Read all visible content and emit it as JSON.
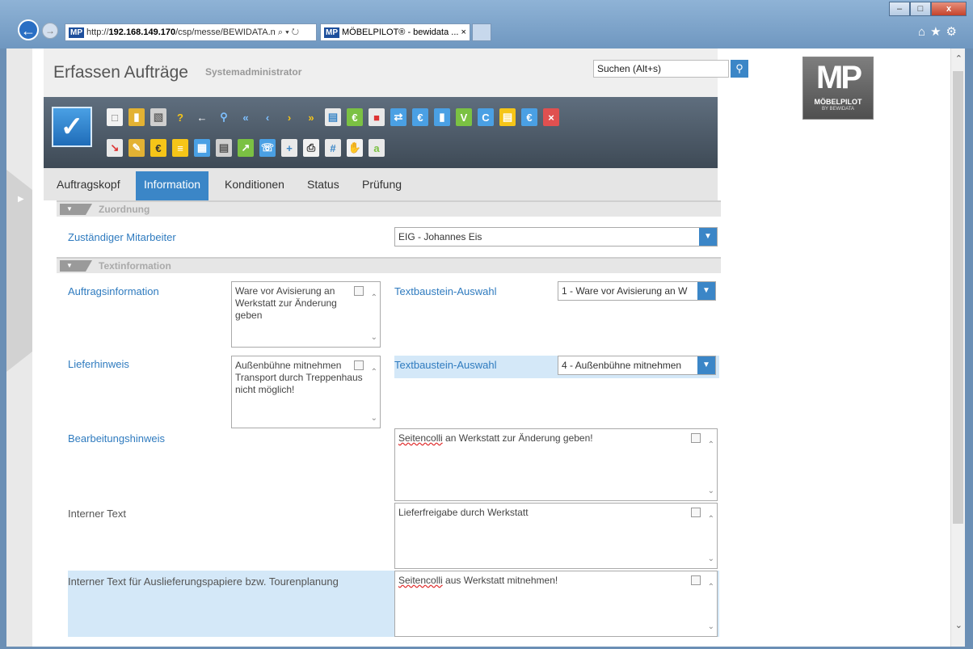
{
  "browser": {
    "url_prefix": "http://",
    "url_host": "192.168.149.170",
    "url_path": "/csp/messe/BEWIDATA.n",
    "url_controls": "⌕ ▾ ↻",
    "favicon_text": "MP",
    "tab_title": "MÖBELPILOT® - bewidata ... ×",
    "window_buttons": [
      "–",
      "□",
      "x"
    ]
  },
  "header": {
    "title": "Erfassen Aufträge",
    "user": "Systemadministrator",
    "search_placeholder": "Suchen (Alt+s)"
  },
  "logo": {
    "big": "MP",
    "name": "MÖBELPILOT",
    "tagline": "BY BEWIDATA"
  },
  "tabs": [
    "Auftragskopf",
    "Information",
    "Konditionen",
    "Status",
    "Prüfung"
  ],
  "active_tab": "Information",
  "sections": {
    "zuordnung": "Zuordnung",
    "textinformation": "Textinformation"
  },
  "form": {
    "mitarbeiter_label": "Zuständiger Mitarbeiter",
    "mitarbeiter_value": "EIG - Johannes Eis",
    "auftragsinfo_label": "Auftragsinformation",
    "auftragsinfo_text": "Ware vor Avisierung an Werkstatt zur Änderung geben",
    "textbaustein1_label": "Textbaustein-Auswahl",
    "textbaustein1_value": "1 - Ware vor Avisierung an W",
    "lieferhinweis_label": "Lieferhinweis",
    "lieferhinweis_text": "Außenbühne mitnehmen Transport durch Treppenhaus nicht möglich!",
    "textbaustein2_label": "Textbaustein-Auswahl",
    "textbaustein2_value": "4 - Außenbühne mitnehmen",
    "bearbeitung_label": "Bearbeitungshinweis",
    "bearbeitung_word": "Seitencolli",
    "bearbeitung_rest": " an Werkstatt zur Änderung geben!",
    "interner_label": "Interner Text",
    "interner_text": "Lieferfreigabe durch Werkstatt",
    "auslieferung_label": "Interner Text für Auslieferungspapiere bzw. Tourenplanung",
    "auslieferung_word": "Seitencolli",
    "auslieferung_rest": " aus Werkstatt mitnehmen!"
  },
  "colors": {
    "accent": "#3b86c7",
    "label_blue": "#2f7bbf",
    "highlight": "#d4e8f8",
    "toolbar": "#4d5a67"
  },
  "toolbar_icons_row1": [
    "new-doc",
    "open-folder",
    "trash",
    "help",
    "back-arrow",
    "search",
    "first",
    "prev",
    "next",
    "last",
    "doc-green",
    "money-doc",
    "card",
    "transfer",
    "transfer-2",
    "truck",
    "doc-v",
    "doc-c",
    "doc-yellow",
    "doc-e",
    "doc-x"
  ],
  "toolbar_icons_row2": [
    "doc-arrow",
    "folder-edit",
    "vehicle-money",
    "doc-list",
    "calendar",
    "doc-grey",
    "doc-export",
    "phone",
    "doc-add",
    "printer",
    "calc",
    "hand-doc",
    "ab-doc"
  ]
}
